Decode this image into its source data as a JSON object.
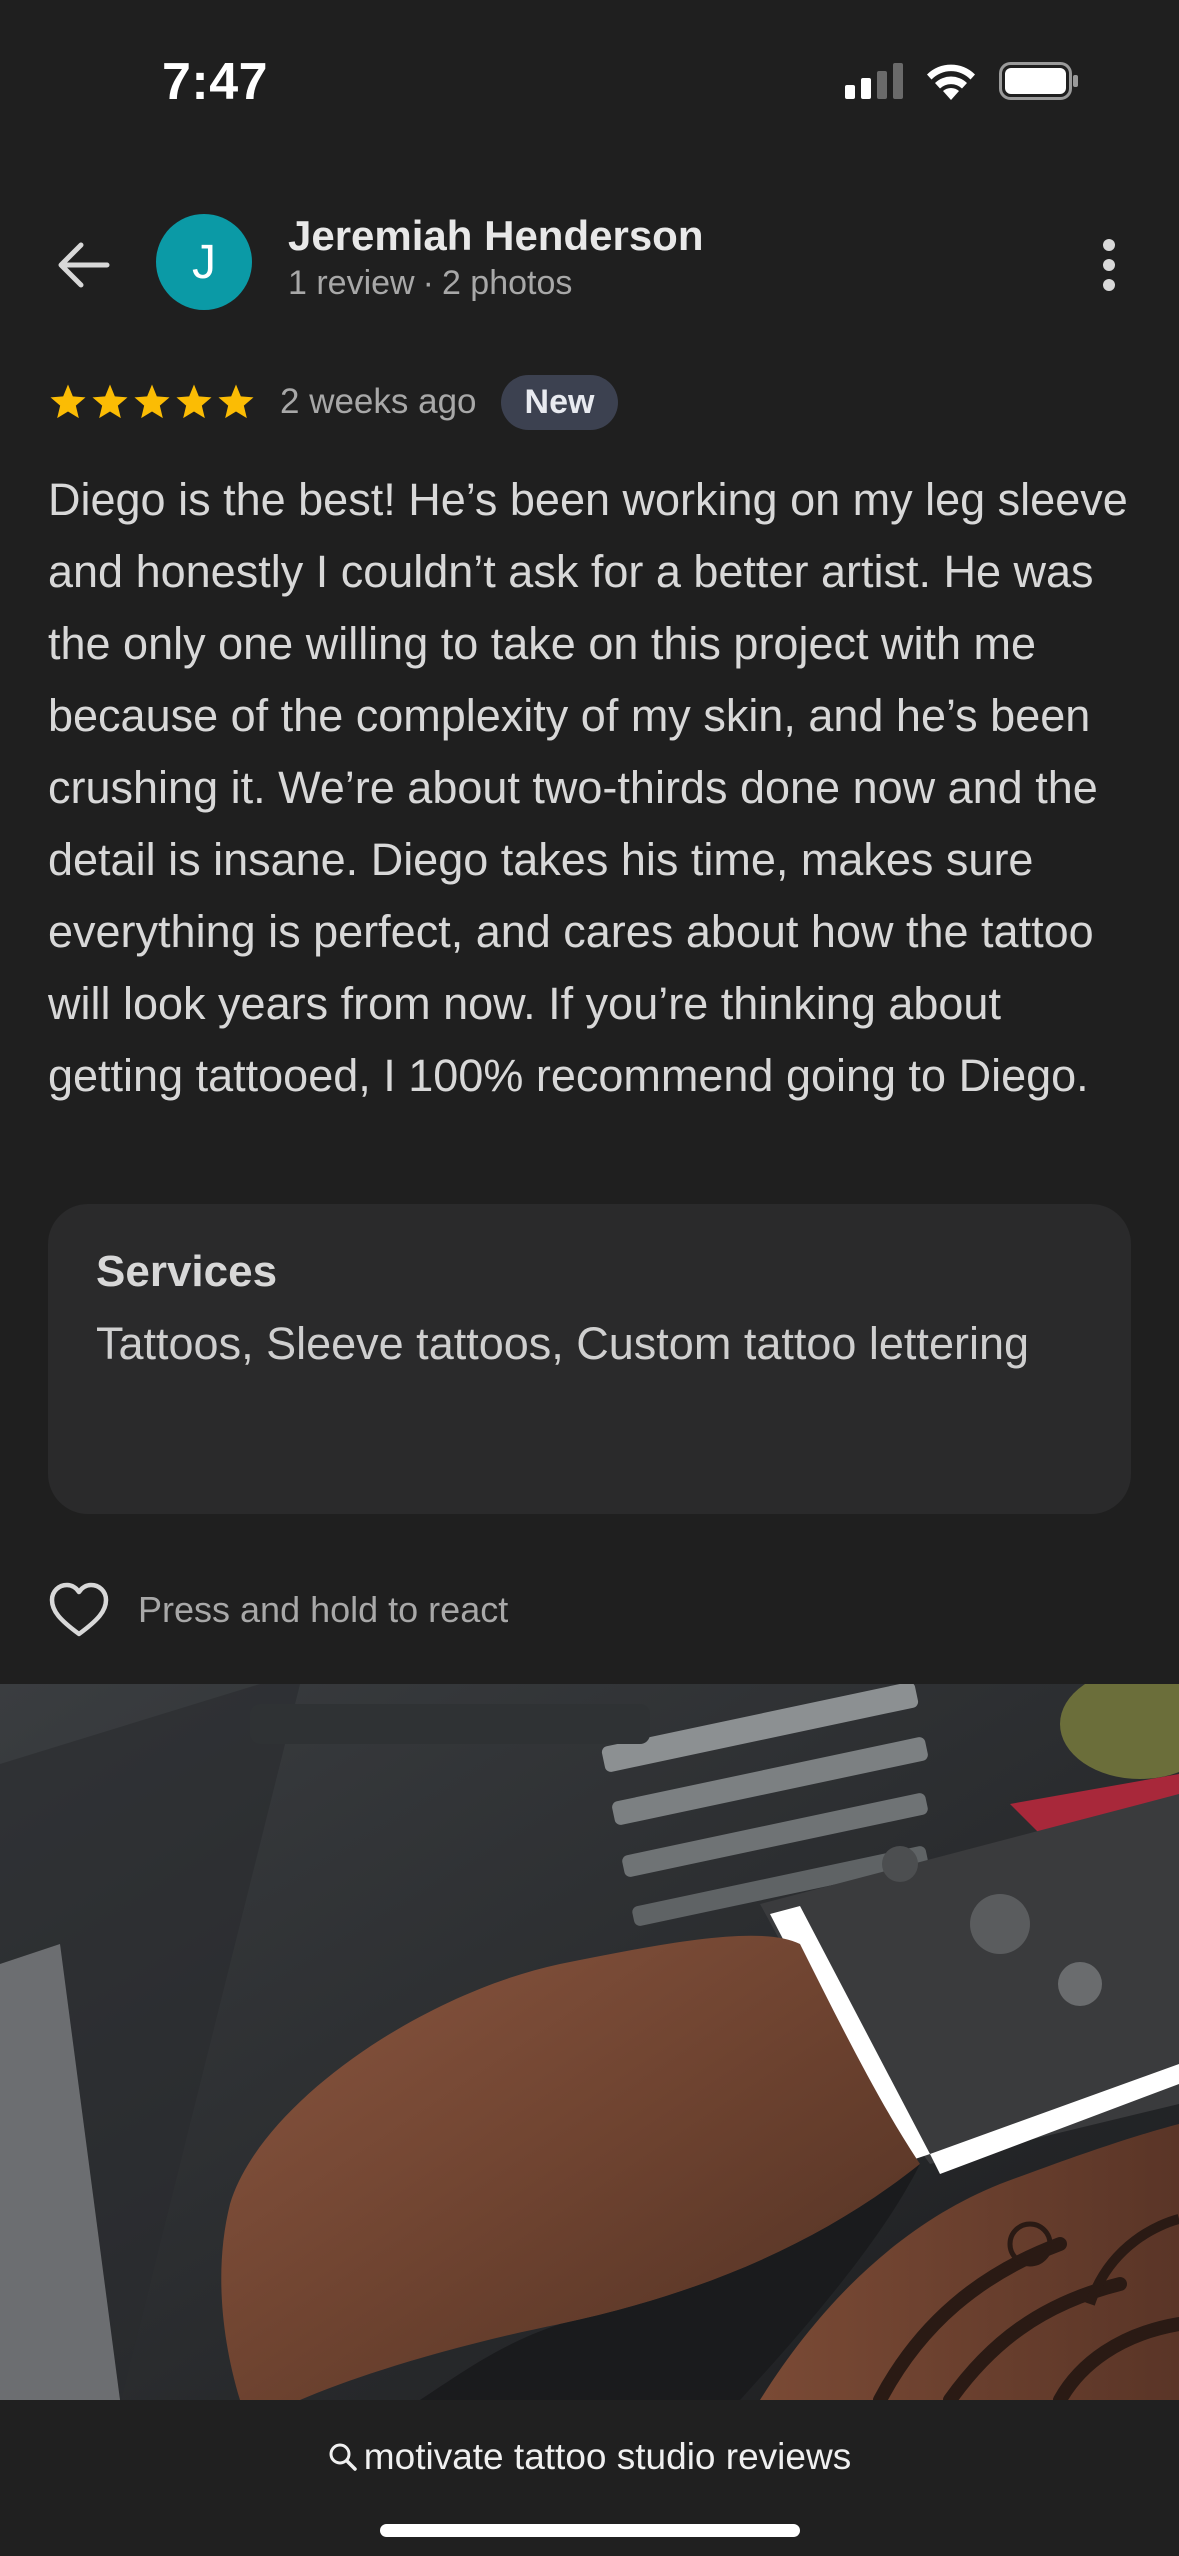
{
  "status_bar": {
    "time": "7:47"
  },
  "header": {
    "avatar_letter": "J",
    "avatar_color": "#0b9aa6",
    "name": "Jeremiah Henderson",
    "review_count": "1 review",
    "separator": "·",
    "photo_count": "2 photos"
  },
  "review": {
    "rating": 5,
    "rating_max": 5,
    "star_color": "#fbbc04",
    "time_ago": "2 weeks ago",
    "badge": "New",
    "text": "Diego is the best! He’s been working on my leg sleeve and honestly I couldn’t ask for a better artist. He was the only one willing to take on this project with me because of the complexity of my skin, and he’s been crushing it. We’re about two-thirds done now and the detail is insane. Diego takes his time, makes sure everything is perfect, and cares about how the tattoo will look years from now. If you’re thinking about getting tattooed, I 100% recommend going to Diego."
  },
  "services": {
    "title": "Services",
    "list": "Tattoos, Sleeve tattoos, Custom tattoo lettering"
  },
  "reaction": {
    "label": "Press and hold to react",
    "icon": "heart-outline-icon"
  },
  "bottom": {
    "search_text": "motivate tattoo studio reviews",
    "search_icon": "search-icon"
  }
}
